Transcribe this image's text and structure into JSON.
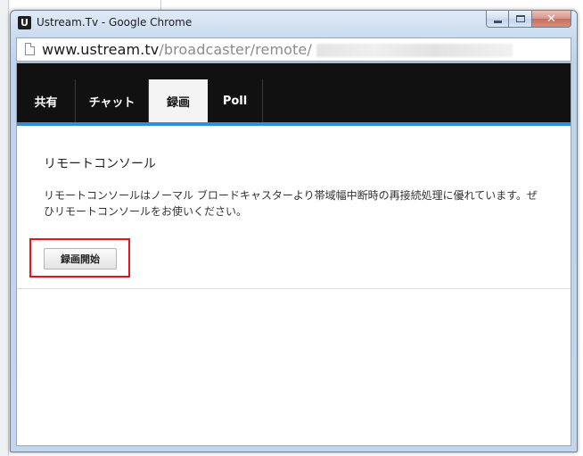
{
  "window": {
    "icon_letter": "U",
    "title": "Ustream.Tv - Google Chrome"
  },
  "address_bar": {
    "url_host": "www.ustream.tv",
    "url_path": "/broadcaster/remote/"
  },
  "tabs": [
    {
      "label": "共有",
      "active": false
    },
    {
      "label": "チャット",
      "active": false
    },
    {
      "label": "録画",
      "active": true
    },
    {
      "label": "Poll",
      "active": false
    }
  ],
  "main": {
    "section_title": "リモートコンソール",
    "description": "リモートコンソールはノーマル ブロードキャスターより帯域幅中断時の再接続処理に優れています。ぜひリモートコンソールをお使いください。",
    "record_button_label": "録画開始"
  },
  "colors": {
    "tabbar_bg": "#111111",
    "accent_blue": "#2f8fd8",
    "highlight_red": "#e8141c"
  }
}
